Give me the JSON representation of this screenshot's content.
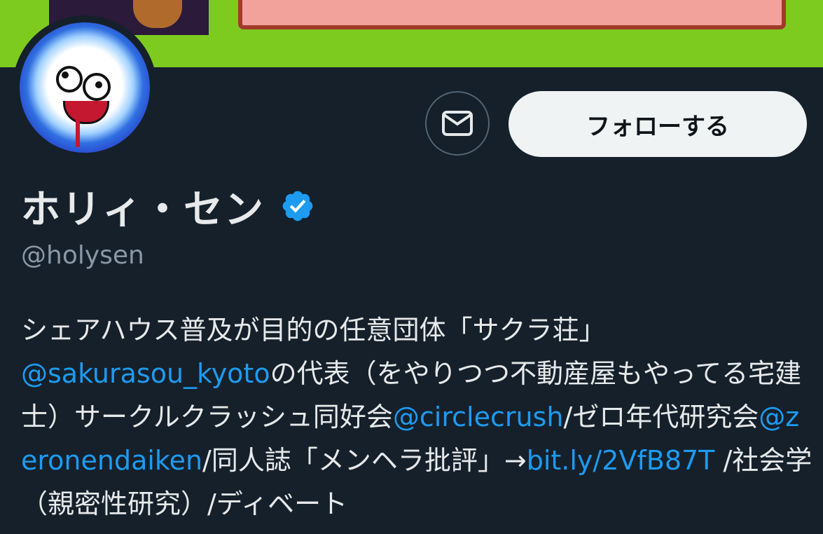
{
  "profile": {
    "display_name": "ホリィ・セン",
    "handle": "@holysen",
    "verified": true,
    "follow_label": "フォローする",
    "message_icon": "envelope-icon",
    "verified_icon": "verified-badge-icon",
    "avatar_icon": "avatar"
  },
  "bio": {
    "t1": "シェアハウス普及が目的の任意団体「サクラ荘」",
    "mention_sakurasou": "@sakurasou_kyoto",
    "t2": "の代表（をやりつつ不動産屋もやってる宅建士）サークルクラッシュ同好会",
    "mention_circlecrush": "@circlecrush",
    "t3": "/ゼロ年代研究会",
    "mention_zeronendaiken": "@zeronendaiken",
    "t4": "/同人誌「メンヘラ批評」→",
    "link": "bit.ly/2VfB87T",
    "t5": " /社会学（親密性研究）/ディベート"
  },
  "colors": {
    "background": "#15202b",
    "banner": "#7ecb1f",
    "link": "#1d9bf0",
    "verified": "#1d9bf0",
    "handle": "#8b98a5",
    "follow_button_bg": "#eff3f4"
  }
}
